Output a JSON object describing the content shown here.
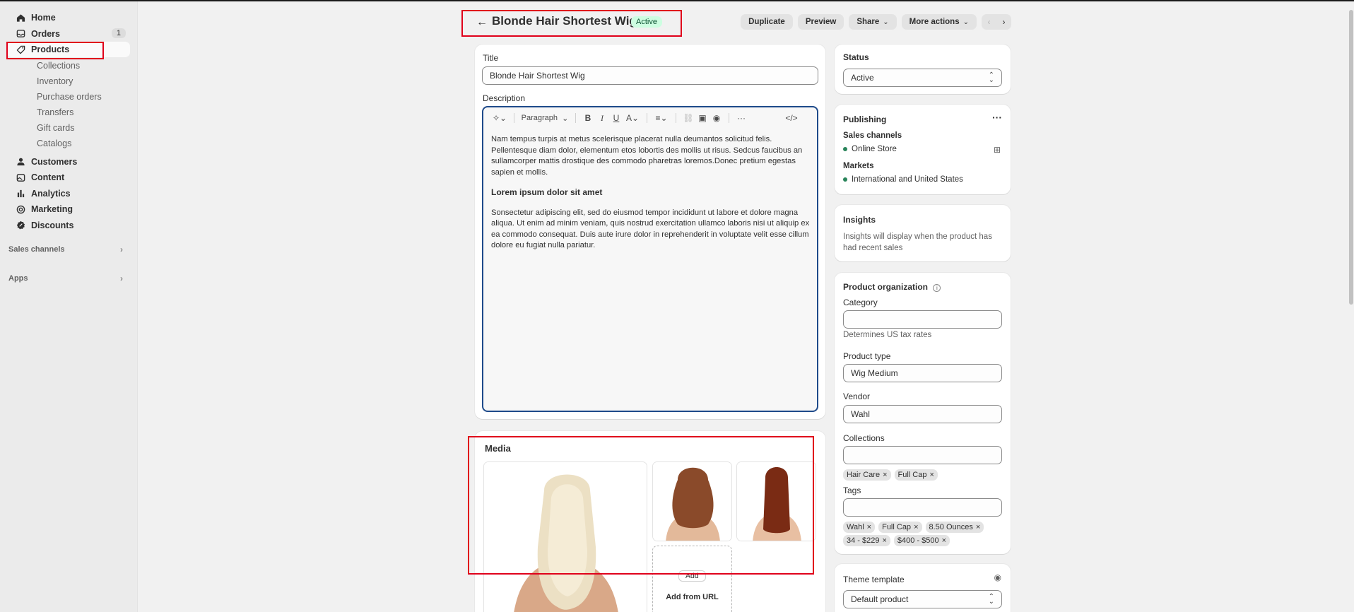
{
  "sidebar": {
    "nav": [
      {
        "label": "Home",
        "icon": "home-icon"
      },
      {
        "label": "Orders",
        "icon": "inbox-icon",
        "count": "1"
      },
      {
        "label": "Products",
        "icon": "tag-icon",
        "active": true
      }
    ],
    "product_sub": [
      "Collections",
      "Inventory",
      "Purchase orders",
      "Transfers",
      "Gift cards",
      "Catalogs"
    ],
    "nav2": [
      {
        "label": "Customers",
        "icon": "person-icon"
      },
      {
        "label": "Content",
        "icon": "image-icon"
      },
      {
        "label": "Analytics",
        "icon": "bar-chart-icon"
      },
      {
        "label": "Marketing",
        "icon": "target-icon"
      },
      {
        "label": "Discounts",
        "icon": "discount-icon"
      }
    ],
    "sales_channels": "Sales channels",
    "apps": "Apps"
  },
  "header": {
    "title": "Blonde Hair Shortest Wig",
    "status": "Active",
    "actions": {
      "duplicate": "Duplicate",
      "preview": "Preview",
      "share": "Share",
      "more": "More actions"
    }
  },
  "main": {
    "title_label": "Title",
    "title_value": "Blonde Hair Shortest Wig",
    "description_label": "Description",
    "toolbar": {
      "paragraph": "Paragraph"
    },
    "description": {
      "p1": "Nam tempus turpis at metus scelerisque placerat nulla deumantos solicitud felis. Pellentesque diam dolor, elementum etos lobortis des mollis ut risus. Sedcus faucibus an sullamcorper mattis drostique des commodo pharetras loremos.Donec pretium egestas sapien et mollis.",
      "heading": "Lorem ipsum dolor sit amet",
      "p2": "Sonsectetur adipiscing elit, sed do eiusmod tempor incididunt ut labore et dolore magna aliqua. Ut enim ad minim veniam, quis nostrud exercitation ullamco laboris nisi ut aliquip ex ea commodo consequat. Duis aute irure dolor in reprehenderit in voluptate velit esse cillum dolore eu fugiat nulla pariatur."
    }
  },
  "media": {
    "title": "Media",
    "add": "Add",
    "add_from_url": "Add from URL"
  },
  "status_card": {
    "label": "Status",
    "value": "Active"
  },
  "publishing": {
    "title": "Publishing",
    "sales_channels_label": "Sales channels",
    "channel": "Online Store",
    "markets_label": "Markets",
    "market": "International and United States"
  },
  "insights": {
    "title": "Insights",
    "text": "Insights will display when the product has had recent sales"
  },
  "organization": {
    "title": "Product organization",
    "category_label": "Category",
    "category_value": "",
    "category_help": "Determines US tax rates",
    "type_label": "Product type",
    "type_value": "Wig Medium",
    "vendor_label": "Vendor",
    "vendor_value": "Wahl",
    "collections_label": "Collections",
    "collections": [
      "Hair Care",
      "Full Cap"
    ],
    "tags_label": "Tags",
    "tags_row1": [
      "Wahl",
      "Full Cap",
      "8.50 Ounces"
    ],
    "tags_row2": [
      "34 - $229",
      "$400 - $500"
    ]
  },
  "theme": {
    "label": "Theme template",
    "value": "Default product"
  },
  "colors": {
    "accent": "#1e4a8a",
    "highlight": "#e0001b",
    "status_bg": "#cdfee1",
    "status_fg": "#0c5132",
    "dot": "#29845a"
  }
}
